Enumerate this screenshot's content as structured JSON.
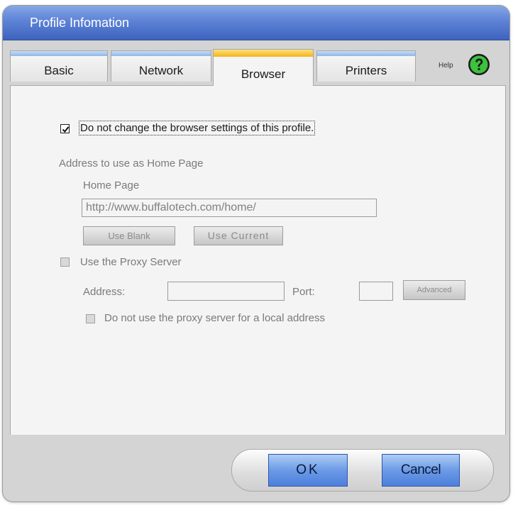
{
  "window": {
    "title": "Profile Infomation"
  },
  "tabs": [
    {
      "label": "Basic"
    },
    {
      "label": "Network"
    },
    {
      "label": "Browser"
    },
    {
      "label": "Printers"
    }
  ],
  "help": {
    "label": "Help",
    "icon": "help-icon"
  },
  "browser": {
    "keep_settings_label": "Do not change the browser settings of this profile.",
    "keep_settings_checked": true,
    "home_section_label": "Address to use as Home Page",
    "home_page_label": "Home Page",
    "home_page_value": "http://www.buffalotech.com/home/",
    "use_blank_label": "Use Blank",
    "use_current_label": "Use Current",
    "proxy_label": "Use the Proxy Server",
    "address_label": "Address:",
    "address_value": "",
    "port_label": "Port:",
    "port_value": "",
    "advanced_label": "Advanced",
    "bypass_local_label": "Do not use the proxy server for a local address"
  },
  "footer": {
    "ok_label": "OK",
    "cancel_label": "Cancel"
  },
  "colors": {
    "title_bar": "#4f74cc",
    "active_tab": "#f3b21d",
    "tab_stripe": "#8fb6e6",
    "primary_button": "#6b9ae6"
  }
}
